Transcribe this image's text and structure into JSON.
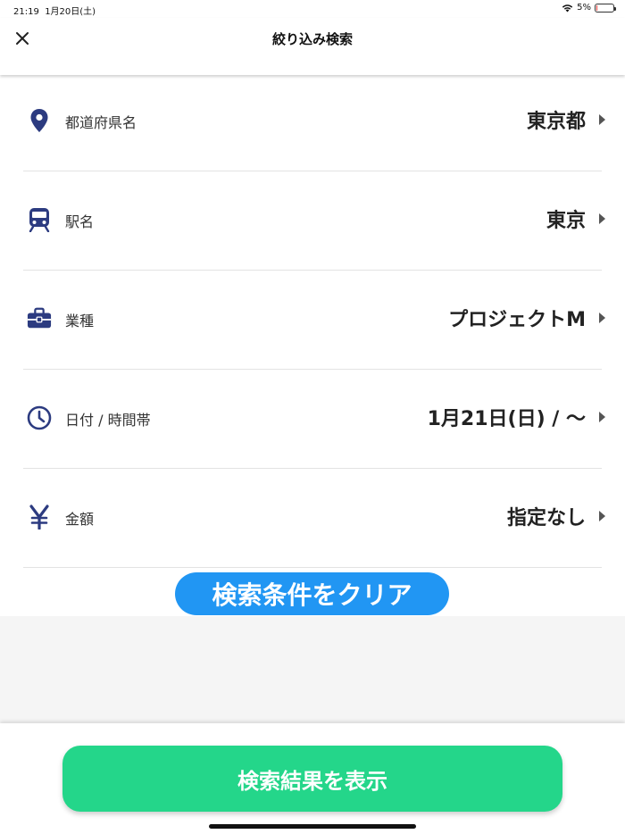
{
  "status_bar": {
    "time": "21:19",
    "date": "1月20日(土)",
    "battery_percent": "5%",
    "battery_level": 0.05
  },
  "header": {
    "title": "絞り込み検索",
    "close_icon": "close-icon"
  },
  "filters": [
    {
      "icon": "map-pin-icon",
      "label": "都道府県名",
      "value": "東京都"
    },
    {
      "icon": "train-icon",
      "label": "駅名",
      "value": "東京"
    },
    {
      "icon": "briefcase-icon",
      "label": "業種",
      "value": "プロジェクトM"
    },
    {
      "icon": "clock-icon",
      "label": "日付 / 時間帯",
      "value": "1月21日(日) / 〜"
    },
    {
      "icon": "yen-icon",
      "label": "金額",
      "value": "指定なし"
    }
  ],
  "clear_button": "検索条件をクリア",
  "show_results_button": "検索結果を表示",
  "colors": {
    "icon": "#2c3b80",
    "clear_button": "#2196f3",
    "results_button": "#24d68a"
  }
}
